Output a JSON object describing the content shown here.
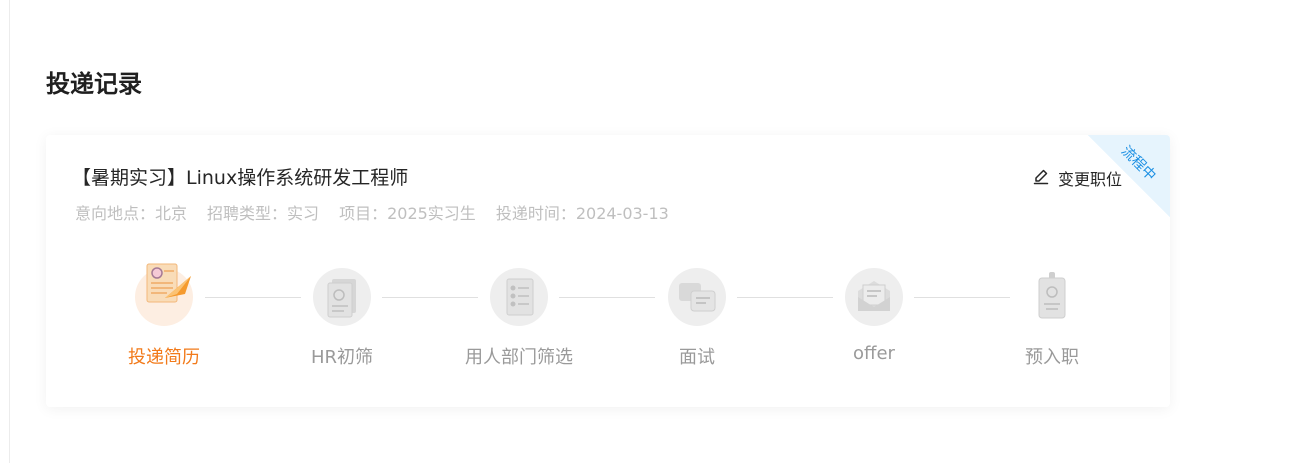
{
  "section_title": "投递记录",
  "card": {
    "job_title": "【暑期实习】Linux操作系统研发工程师",
    "status_ribbon": "流程中",
    "change_button": {
      "label": "变更职位",
      "icon": "edit-icon"
    },
    "meta": [
      {
        "label": "意向地点：",
        "value": "北京"
      },
      {
        "label": "招聘类型：",
        "value": "实习"
      },
      {
        "label": "项目：",
        "value": "2025实习生"
      },
      {
        "label": "投递时间：",
        "value": "2024-03-13"
      }
    ],
    "steps": [
      {
        "label": "投递简历",
        "icon": "resume-submit-icon",
        "active": true
      },
      {
        "label": "HR初筛",
        "icon": "hr-screen-icon",
        "active": false
      },
      {
        "label": "用人部门筛选",
        "icon": "department-screen-icon",
        "active": false
      },
      {
        "label": "面试",
        "icon": "interview-icon",
        "active": false
      },
      {
        "label": "offer",
        "icon": "offer-icon",
        "active": false
      },
      {
        "label": "预入职",
        "icon": "pre-onboarding-icon",
        "active": false
      }
    ]
  },
  "colors": {
    "active": "#f27a1a",
    "inactive": "#9a9a9a",
    "ribbon_text": "#1b8fe3",
    "ribbon_bg": "#e6f4fd"
  }
}
